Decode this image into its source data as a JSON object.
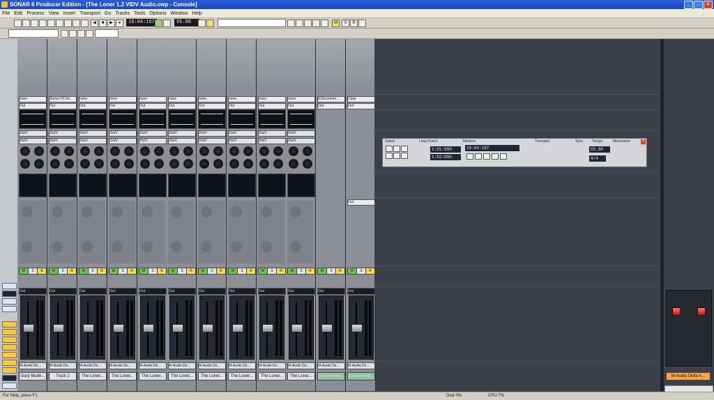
{
  "window": {
    "title": "SONAR 6 Producer Edition - [The Loner 1.2 VIDV Audio.cwp - Console]"
  },
  "menu": [
    "File",
    "Edit",
    "Process",
    "View",
    "Insert",
    "Transport",
    "Go",
    "Tracks",
    "Tools",
    "Options",
    "Window",
    "Help"
  ],
  "toolbar": {
    "time": "10:04:167",
    "tempo": "95.00",
    "marker_label": "M",
    "solo_label": "S",
    "rec_label": "R"
  },
  "strips": [
    {
      "name": "Gary Mode...",
      "input": "none",
      "kind": "track"
    },
    {
      "name": "Track 2",
      "input": "Stereo Hi Ins...",
      "kind": "track"
    },
    {
      "name": "The Loner...",
      "input": "none",
      "kind": "track"
    },
    {
      "name": "The Loner...",
      "input": "none",
      "kind": "track"
    },
    {
      "name": "The Loner...",
      "input": "none",
      "kind": "track"
    },
    {
      "name": "The Loner...",
      "input": "none",
      "kind": "track"
    },
    {
      "name": "The Loner...",
      "input": "none",
      "kind": "track"
    },
    {
      "name": "The Loner...",
      "input": "none",
      "kind": "track"
    },
    {
      "name": "The Loner...",
      "input": "none",
      "kind": "track"
    },
    {
      "name": "The Loner...",
      "input": "none",
      "kind": "track"
    },
    {
      "name": "Ezdrummer...",
      "input": "EZdrummer...",
      "kind": "bus"
    },
    {
      "name": "Ezdrummer...",
      "input": "Clear",
      "kind": "bus"
    }
  ],
  "strip_common": {
    "sends": "2/a/V",
    "out": "Out",
    "bus": "Out",
    "msr": [
      "S",
      "M",
      "R"
    ],
    "bot": "M-Audio De..."
  },
  "transport": {
    "time": "10:04:167",
    "measure": "1:01:000",
    "sub": "1:02:000",
    "tempo": "95.00",
    "sig": "4/4",
    "section_labels": [
      "Select",
      "Loop Punch",
      "Markers",
      "Transport",
      "Sync",
      "Tempo",
      "Metronome"
    ]
  },
  "master": {
    "name": "M-Audio Delta A..."
  },
  "status": {
    "left": "For Help, press F1",
    "cpu": "Disk 0%",
    "right": "CPU 7%"
  }
}
